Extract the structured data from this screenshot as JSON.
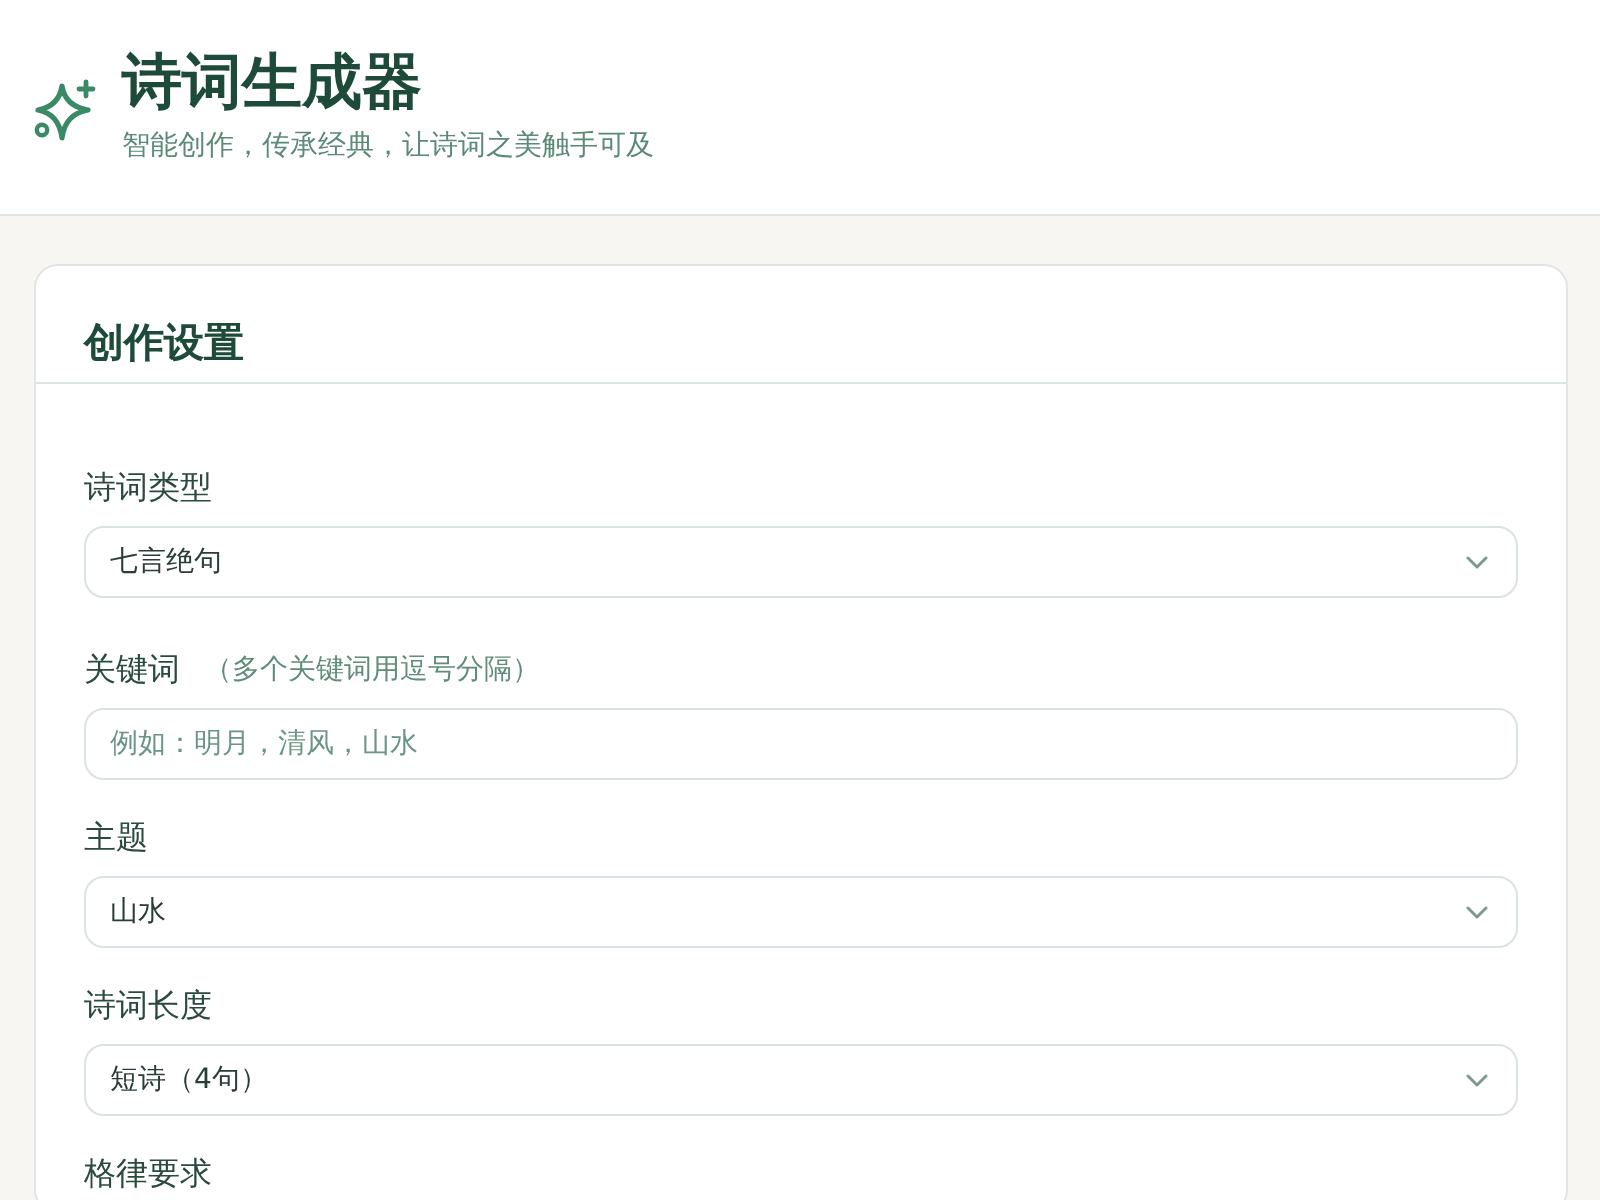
{
  "header": {
    "title": "诗词生成器",
    "subtitle": "智能创作，传承经典，让诗词之美触手可及"
  },
  "settings": {
    "title": "创作设置",
    "fields": [
      {
        "kind": "select",
        "label": "诗词类型",
        "value": "七言绝句"
      },
      {
        "kind": "input",
        "label": "关键词",
        "hint": "（多个关键词用逗号分隔）",
        "placeholder": "例如：明月，清风，山水"
      },
      {
        "kind": "select",
        "label": "主题",
        "value": "山水"
      },
      {
        "kind": "select",
        "label": "诗词长度",
        "value": "短诗（4句）"
      },
      {
        "kind": "cut",
        "label": "格律要求"
      }
    ]
  }
}
